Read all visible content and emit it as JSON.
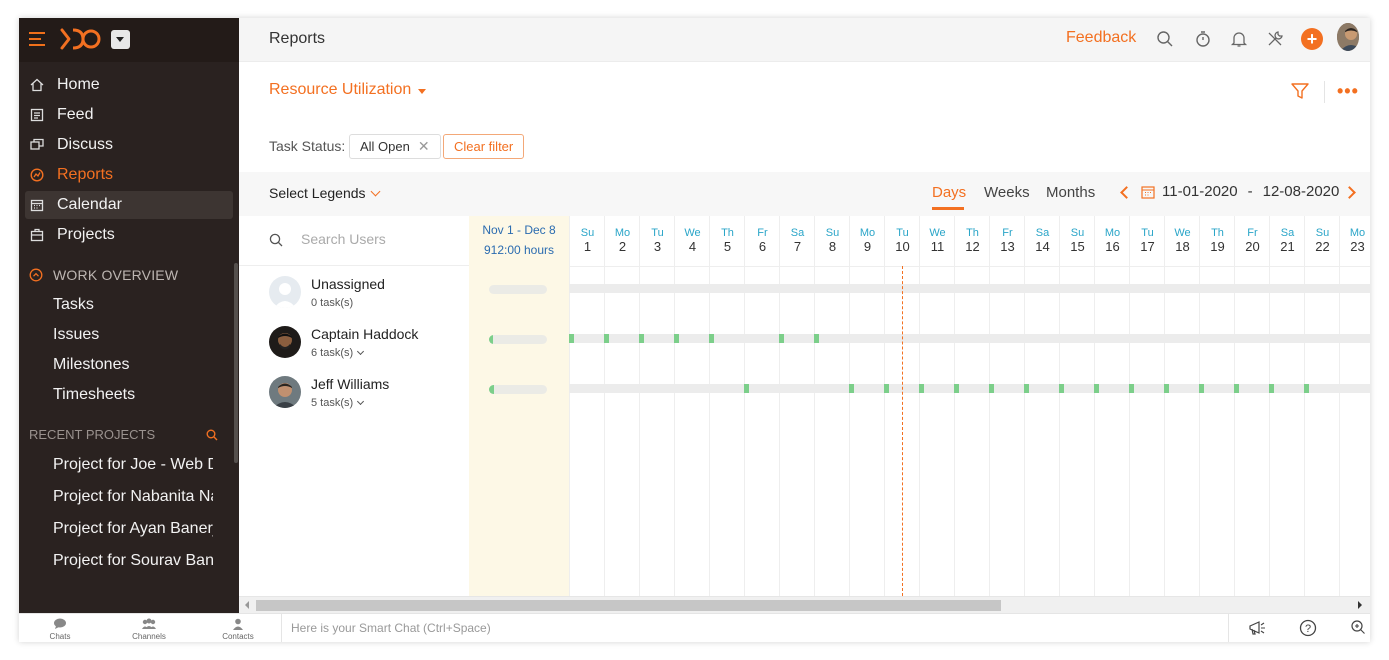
{
  "sidebar": {
    "nav": [
      {
        "label": "Home",
        "icon": "home-icon"
      },
      {
        "label": "Feed",
        "icon": "feed-icon"
      },
      {
        "label": "Discuss",
        "icon": "discuss-icon"
      },
      {
        "label": "Reports",
        "icon": "reports-icon",
        "active": true
      },
      {
        "label": "Calendar",
        "icon": "calendar-icon"
      },
      {
        "label": "Projects",
        "icon": "projects-icon"
      }
    ],
    "work_overview": {
      "title": "WORK OVERVIEW",
      "items": [
        "Tasks",
        "Issues",
        "Milestones",
        "Timesheets"
      ]
    },
    "recent_projects": {
      "title": "RECENT PROJECTS",
      "items": [
        "Project for Joe - Web D",
        "Project for Nabanita Na",
        "Project for Ayan Banerj",
        "Project for Sourav Bane"
      ]
    }
  },
  "header": {
    "title": "Reports",
    "feedback": "Feedback"
  },
  "report": {
    "title": "Resource Utilization",
    "filter_label": "Task Status:",
    "filter_value": "All Open",
    "clear_filter": "Clear filter",
    "select_legends": "Select Legends",
    "views": [
      "Days",
      "Weeks",
      "Months"
    ],
    "active_view": "Days",
    "date_from": "11-01-2020",
    "date_sep": "-",
    "date_to": "12-08-2020"
  },
  "grid": {
    "search_placeholder": "Search Users",
    "summary_range": "Nov 1 - Dec 8",
    "summary_hours": "912:00 hours",
    "days": [
      {
        "n": "Su",
        "d": "1"
      },
      {
        "n": "Mo",
        "d": "2"
      },
      {
        "n": "Tu",
        "d": "3"
      },
      {
        "n": "We",
        "d": "4"
      },
      {
        "n": "Th",
        "d": "5"
      },
      {
        "n": "Fr",
        "d": "6"
      },
      {
        "n": "Sa",
        "d": "7"
      },
      {
        "n": "Su",
        "d": "8"
      },
      {
        "n": "Mo",
        "d": "9"
      },
      {
        "n": "Tu",
        "d": "10"
      },
      {
        "n": "We",
        "d": "11"
      },
      {
        "n": "Th",
        "d": "12"
      },
      {
        "n": "Fr",
        "d": "13"
      },
      {
        "n": "Sa",
        "d": "14"
      },
      {
        "n": "Su",
        "d": "15"
      },
      {
        "n": "Mo",
        "d": "16"
      },
      {
        "n": "Tu",
        "d": "17"
      },
      {
        "n": "We",
        "d": "18"
      },
      {
        "n": "Th",
        "d": "19"
      },
      {
        "n": "Fr",
        "d": "20"
      },
      {
        "n": "Sa",
        "d": "21"
      },
      {
        "n": "Su",
        "d": "22"
      },
      {
        "n": "Mo",
        "d": "23"
      }
    ],
    "today_day": 10,
    "users": [
      {
        "name": "Unassigned",
        "tasks": "0 task(s)",
        "has_menu": false,
        "active_days": []
      },
      {
        "name": "Captain Haddock",
        "tasks": "6 task(s)",
        "has_menu": true,
        "active_days": [
          1,
          2,
          3,
          4,
          5,
          7,
          8
        ]
      },
      {
        "name": "Jeff Williams",
        "tasks": "5 task(s)",
        "has_menu": true,
        "active_days": [
          6,
          9,
          10,
          11,
          12,
          13,
          14,
          15,
          16,
          17,
          18,
          19,
          20,
          21,
          22
        ]
      }
    ]
  },
  "bottombar": {
    "chats": "Chats",
    "channels": "Channels",
    "contacts": "Contacts",
    "smart_chat_placeholder": "Here is your Smart Chat (Ctrl+Space)"
  },
  "colors": {
    "accent": "#f37021",
    "sidebar_bg": "#2a2220",
    "busy": "#7ccf8a",
    "day_name": "#2aa5c8"
  }
}
